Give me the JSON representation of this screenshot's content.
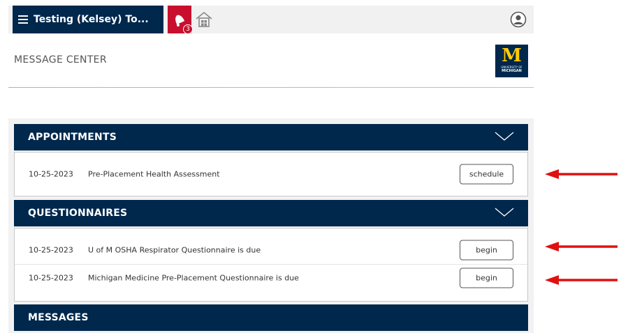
{
  "header": {
    "menu_label": "Testing (Kelsey) To...",
    "menu_icon": "hamburger-icon",
    "notification_count": "3",
    "notification_icon": "bell-icon",
    "home_icon": "home-icon",
    "account_icon": "user-circle-icon"
  },
  "page": {
    "title": "MESSAGE CENTER"
  },
  "logo": {
    "letter": "M",
    "line1": "UNIVERSITY OF",
    "line2": "MICHIGAN"
  },
  "sections": {
    "appointments": {
      "title": "APPOINTMENTS",
      "items": [
        {
          "date": "10-25-2023",
          "description": "Pre-Placement Health Assessment",
          "action": "schedule"
        }
      ]
    },
    "questionnaires": {
      "title": "QUESTIONNAIRES",
      "items": [
        {
          "date": "10-25-2023",
          "description": "U of M OSHA Respirator Questionnaire is due",
          "action": "begin"
        },
        {
          "date": "10-25-2023",
          "description": "Michigan Medicine Pre-Placement Questionnaire is due",
          "action": "begin"
        }
      ]
    },
    "messages": {
      "title": "MESSAGES"
    }
  },
  "colors": {
    "navy": "#00274c",
    "maize": "#ffcb05",
    "alert_red": "#c8102e",
    "arrow_red": "#e01010"
  }
}
